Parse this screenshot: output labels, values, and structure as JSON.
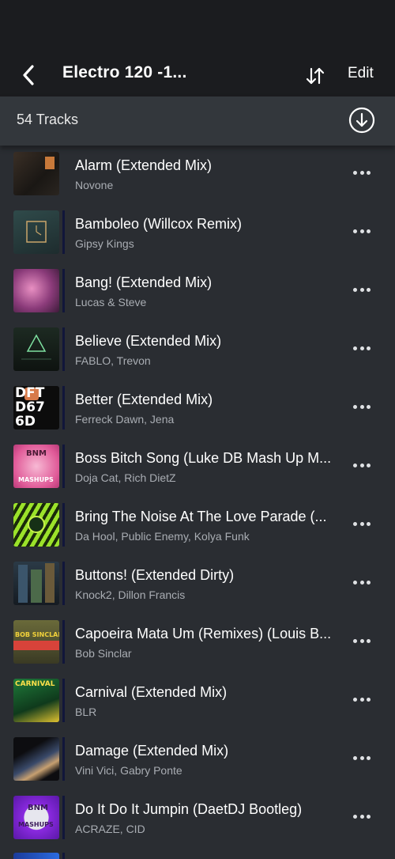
{
  "header": {
    "title": "Electro 120 -1...",
    "edit_label": "Edit",
    "back_icon": "chevron-left-icon",
    "sort_icon": "sort-arrows-icon"
  },
  "subbar": {
    "track_count": "54 Tracks",
    "download_icon": "download-circle-icon"
  },
  "tracks": [
    {
      "title": "Alarm (Extended Mix)",
      "artist": "Novone",
      "art": "dark-brown"
    },
    {
      "title": "Bamboleo (Willcox Remix)",
      "artist": "Gipsy Kings",
      "art": "teal-clock"
    },
    {
      "title": "Bang! (Extended Mix)",
      "artist": "Lucas & Steve",
      "art": "pink-cloud"
    },
    {
      "title": "Believe (Extended Mix)",
      "artist": "FABLO, Trevon",
      "art": "dark-green-triangle"
    },
    {
      "title": "Better (Extended Mix)",
      "artist": "Ferreck Dawn, Jena",
      "art": "black-white-text"
    },
    {
      "title": "Boss Bitch Song (Luke DB Mash Up M...",
      "artist": "Doja Cat, Rich DietZ",
      "art": "pink-mashups"
    },
    {
      "title": "Bring The Noise At The Love Parade (...",
      "artist": "Da Hool, Public Enemy, Kolya Funk",
      "art": "green-zebra"
    },
    {
      "title": "Buttons! (Extended Dirty)",
      "artist": "Knock2, Dillon Francis",
      "art": "city-buildings"
    },
    {
      "title": "Capoeira Mata Um (Remixes) (Louis B...",
      "artist": "Bob Sinclar",
      "art": "bob-sinclar"
    },
    {
      "title": "Carnival (Extended Mix)",
      "artist": "BLR",
      "art": "carnival"
    },
    {
      "title": "Damage (Extended Mix)",
      "artist": "Vini Vici, Gabry Ponte",
      "art": "dark-streaks"
    },
    {
      "title": "Do It Do It Jumpin (DaetDJ Bootleg)",
      "artist": "ACRAZE, CID",
      "art": "purple-mashups"
    }
  ],
  "art_labels": {
    "better": [
      "DFT",
      "D67",
      "6D"
    ],
    "bnm": "BNM",
    "mashups": "MASHUPS",
    "bob": "BOB SINCLAR",
    "carnival": "CARNIVAL"
  },
  "colors": {
    "header_bg": "#1b1c1f",
    "subbar_bg": "#33373c",
    "list_bg": "#2a2d32",
    "artist_text": "#a9adb3"
  }
}
